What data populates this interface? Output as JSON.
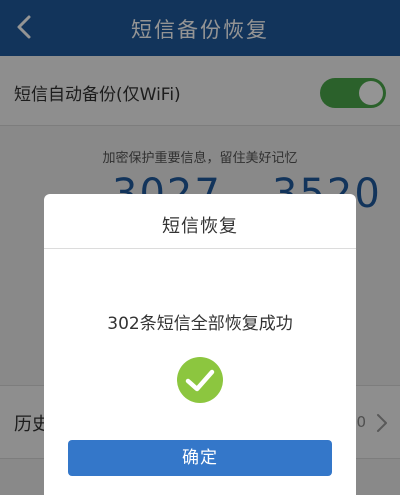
{
  "header": {
    "title": "短信备份恢复",
    "back_icon": "chevron-left-icon"
  },
  "settings": {
    "auto_backup_label": "短信自动备份(仅WiFi)",
    "auto_backup_enabled": true,
    "toggle_color": "#4aa84a"
  },
  "main": {
    "tagline": "加密保护重要信息，留住美好记忆",
    "stat_left_partial": "3027",
    "stat_right_partial": "3520"
  },
  "history": {
    "label": "历史",
    "value_partial": "0",
    "chevron_icon": "chevron-right-icon"
  },
  "dialog": {
    "title": "短信恢复",
    "message": "302条短信全部恢复成功",
    "success_icon": "check-circle-icon",
    "success_color": "#8cc63f",
    "confirm_label": "确定",
    "confirm_color": "#3477c9"
  },
  "colors": {
    "brand": "#1f5a9e"
  }
}
